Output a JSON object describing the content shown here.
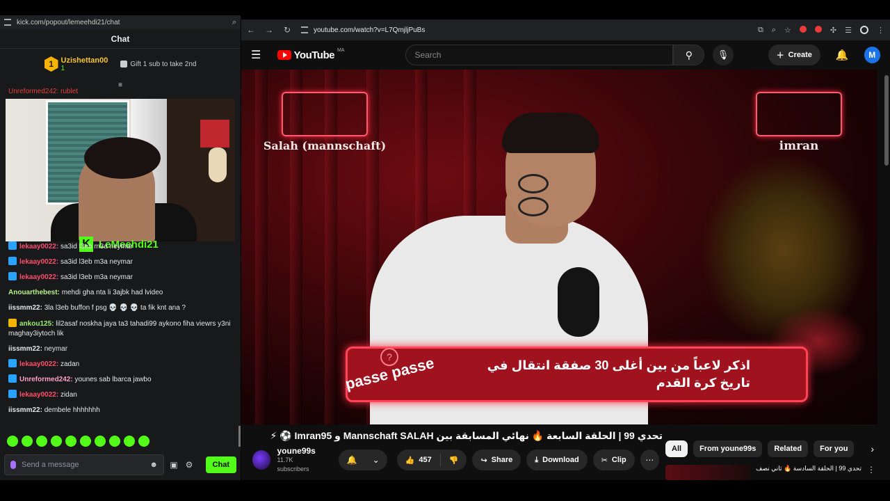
{
  "kick": {
    "url": "kick.com/popout/lemeehdi21/chat",
    "chat_title": "Chat",
    "pinned": {
      "rank": "1",
      "user": "Uzishettan00",
      "sub_count": "1",
      "gift_text": "Gift 1 sub to take 2nd"
    },
    "cut_message": "Unreformed242: rublet",
    "streamer": "LeMeehdi21",
    "messages": [
      {
        "badge": "blue",
        "user": "lekaay0022:",
        "text": "sa3id l3eb m3a neymar",
        "style": "red"
      },
      {
        "badge": "blue",
        "user": "lekaay0022:",
        "text": "sa3id l3eb m3a neymar",
        "style": "red"
      },
      {
        "badge": "blue",
        "user": "lekaay0022:",
        "text": "sa3id l3eb m3a neymar",
        "style": "red"
      },
      {
        "badge": "",
        "user": "Anouarthebest:",
        "text": "mehdi gha nta li 3ajbk had lvideo",
        "style": "green"
      },
      {
        "badge": "",
        "user": "iissmm22:",
        "text": "3la l3eb buffon f psg 💀 💀 💀 ta fik knt ana ?",
        "style": "white"
      },
      {
        "badge": "gold",
        "user": "ankou125:",
        "text": "lil2asaf noskha jaya ta3 tahadi99 aykono fiha viewrs y3ni maghay3iytoch lik",
        "style": "lime"
      },
      {
        "badge": "",
        "user": "iissmm22:",
        "text": "neymar",
        "style": "white"
      },
      {
        "badge": "blue",
        "user": "lekaay0022:",
        "text": "zadan",
        "style": "red"
      },
      {
        "badge": "blue",
        "user": "Unreformed242:",
        "text": "younes sab lbarca jawbo",
        "style": "pink"
      },
      {
        "badge": "blue",
        "user": "lekaay0022:",
        "text": "zidan",
        "style": "red"
      },
      {
        "badge": "",
        "user": "iissmm22:",
        "text": "dembele hhhhhhh",
        "style": "white"
      }
    ],
    "input_placeholder": "Send a message",
    "chat_button": "Chat"
  },
  "browser": {
    "url": "youtube.com/watch?v=L7QmjljPuBs"
  },
  "youtube": {
    "logo_text": "YouTube",
    "country": "MA",
    "search_placeholder": "Search",
    "create_label": "Create",
    "avatar_letter": "M",
    "video": {
      "label_left": "Salah (mannschaft)",
      "label_right": "imran",
      "question": "اذكر لاعباً من بين أغلى 30 صفقة انتقال في تاريخ كرة القدم",
      "segment": "passe passe"
    },
    "title": "تحدي 99 | الحلقة السابعة 🔥 نهائي المسابقة بين Mannschaft SALAH و Imran95 ⚽ ⚡",
    "channel": {
      "name": "youne99s",
      "subscribers": "11.7K subscribers"
    },
    "likes": "457",
    "share_label": "Share",
    "download_label": "Download",
    "clip_label": "Clip",
    "filters": [
      "All",
      "From youne99s",
      "Related",
      "For you"
    ],
    "recommended_title": "تحدي 99 | الحلقة السادسة 🔥 ثاني نصف..."
  }
}
